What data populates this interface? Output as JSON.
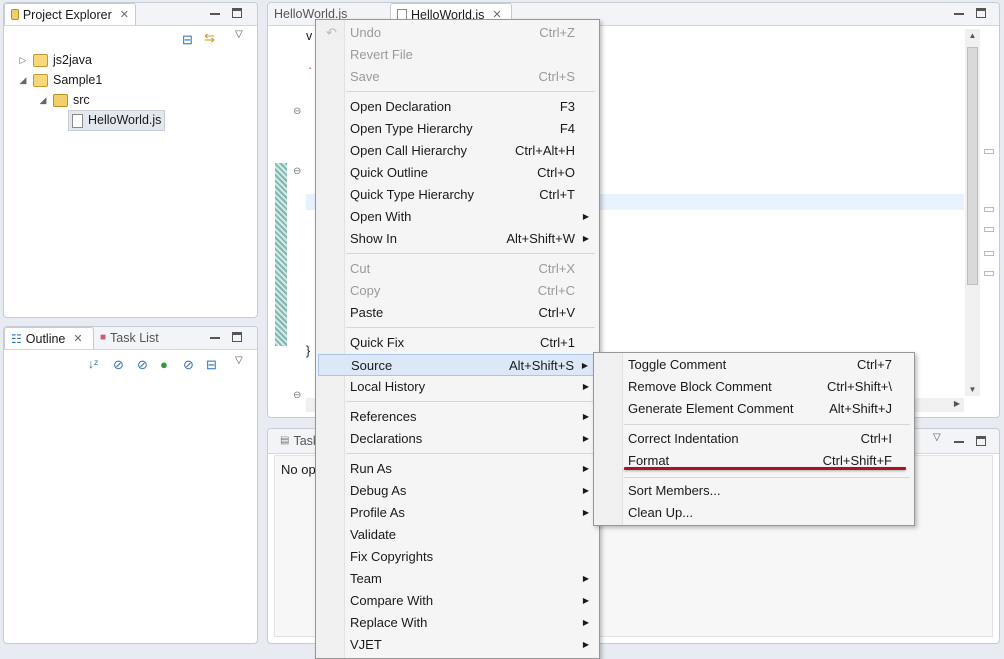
{
  "project_explorer": {
    "title": "Project Explorer",
    "tree": [
      {
        "label": "js2java",
        "level": 0,
        "expanded": false,
        "icon": "project-icon"
      },
      {
        "label": "Sample1",
        "level": 0,
        "expanded": true,
        "icon": "project-icon"
      },
      {
        "label": "src",
        "level": 1,
        "expanded": true,
        "icon": "folder-icon"
      },
      {
        "label": "HelloWorld.js",
        "level": 2,
        "icon": "js-file-icon",
        "selected": true
      }
    ]
  },
  "outline": {
    "title": "Outline",
    "task_list_title": "Task List"
  },
  "editor": {
    "tabs": [
      {
        "label": "HelloWorld.js",
        "active": false
      },
      {
        "label": "HelloWorld.js",
        "active": true
      }
    ],
    "code_fragments": {
      "line1": "v",
      "line2": "·",
      "closing_brace": "}"
    }
  },
  "bottom_panel": {
    "title": "Task",
    "status_text": "No op"
  },
  "context_menu": {
    "items": [
      {
        "label": "Undo",
        "accel": "Ctrl+Z",
        "disabled": true
      },
      {
        "label": "Revert File",
        "accel": "",
        "disabled": true
      },
      {
        "label": "Save",
        "accel": "Ctrl+S",
        "disabled": true
      },
      {
        "label": "Open Declaration",
        "accel": "F3"
      },
      {
        "label": "Open Type Hierarchy",
        "accel": "F4"
      },
      {
        "label": "Open Call Hierarchy",
        "accel": "Ctrl+Alt+H"
      },
      {
        "label": "Quick Outline",
        "accel": "Ctrl+O"
      },
      {
        "label": "Quick Type Hierarchy",
        "accel": "Ctrl+T"
      },
      {
        "label": "Open With",
        "accel": ""
      },
      {
        "label": "Show In",
        "accel": "Alt+Shift+W"
      },
      {
        "label": "Cut",
        "accel": "Ctrl+X",
        "disabled": true
      },
      {
        "label": "Copy",
        "accel": "Ctrl+C",
        "disabled": true
      },
      {
        "label": "Paste",
        "accel": "Ctrl+V"
      },
      {
        "label": "Quick Fix",
        "accel": "Ctrl+1"
      },
      {
        "label": "Source",
        "accel": "Alt+Shift+S",
        "highlighted": true
      },
      {
        "label": "Local History",
        "accel": ""
      },
      {
        "label": "References",
        "accel": ""
      },
      {
        "label": "Declarations",
        "accel": ""
      },
      {
        "label": "Run As",
        "accel": ""
      },
      {
        "label": "Debug As",
        "accel": ""
      },
      {
        "label": "Profile As",
        "accel": ""
      },
      {
        "label": "Validate",
        "accel": ""
      },
      {
        "label": "Fix Copyrights",
        "accel": ""
      },
      {
        "label": "Team",
        "accel": ""
      },
      {
        "label": "Compare With",
        "accel": ""
      },
      {
        "label": "Replace With",
        "accel": ""
      },
      {
        "label": "VJET",
        "accel": ""
      }
    ]
  },
  "source_submenu": {
    "items": [
      {
        "label": "Toggle Comment",
        "accel": "Ctrl+7"
      },
      {
        "label": "Remove Block Comment",
        "accel": "Ctrl+Shift+\\"
      },
      {
        "label": "Generate Element Comment",
        "accel": "Alt+Shift+J"
      },
      {
        "label": "Correct Indentation",
        "accel": "Ctrl+I"
      },
      {
        "label": "Format",
        "accel": "Ctrl+Shift+F",
        "annotated": true
      },
      {
        "label": "Sort Members...",
        "accel": ""
      },
      {
        "label": "Clean Up...",
        "accel": ""
      }
    ]
  },
  "colors": {
    "annotation_underline": "#b01020",
    "menu_highlight": "#dce8f7"
  }
}
